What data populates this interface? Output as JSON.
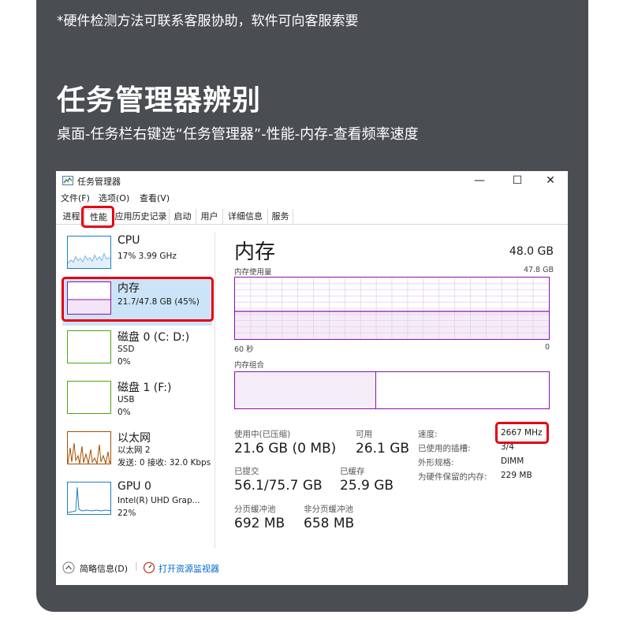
{
  "banner": {
    "note": "*硬件检测方法可联系客服协助，软件可向客服索要",
    "title": "任务管理器辨别",
    "subtitle": "桌面-任务栏右键选“任务管理器”-性能-内存-查看频率速度"
  },
  "window": {
    "title": "任务管理器",
    "minimize": "—",
    "maximize": "☐",
    "close": "✕",
    "menu": [
      "文件(F)",
      "选项(O)",
      "查看(V)"
    ],
    "tabs": [
      "进程",
      "性能",
      "应用历史记录",
      "启动",
      "用户",
      "详细信息",
      "服务"
    ],
    "active_tab": "性能"
  },
  "resources": [
    {
      "name": "CPU",
      "line1": "17% 3.99 GHz",
      "line2": ""
    },
    {
      "name": "内存",
      "line1": "21.7/47.8 GB (45%)",
      "line2": ""
    },
    {
      "name": "磁盘 0 (C: D:)",
      "line1": "SSD",
      "line2": "0%"
    },
    {
      "name": "磁盘 1 (F:)",
      "line1": "USB",
      "line2": "0%"
    },
    {
      "name": "以太网",
      "line1": "以太网 2",
      "line2": "发送: 0 接收: 32.0 Kbps"
    },
    {
      "name": "GPU 0",
      "line1": "Intel(R) UHD Grap...",
      "line2": "22%"
    }
  ],
  "memory": {
    "title": "内存",
    "total": "48.0 GB",
    "usage_label": "内存使用量",
    "usage_max": "47.8 GB",
    "time_left": "60 秒",
    "time_right": "0",
    "composition_label": "内存组合",
    "in_use_fraction": 0.45,
    "stats": {
      "in_use_label": "使用中(已压缩)",
      "in_use_value": "21.6 GB (0 MB)",
      "available_label": "可用",
      "available_value": "26.1 GB",
      "committed_label": "已提交",
      "committed_value": "56.1/75.7 GB",
      "cached_label": "已缓存",
      "cached_value": "25.9 GB",
      "paged_label": "分页缓冲池",
      "paged_value": "692 MB",
      "nonpaged_label": "非分页缓冲池",
      "nonpaged_value": "658 MB"
    },
    "specs": {
      "speed_label": "速度:",
      "speed_value": "2667 MHz",
      "slots_label": "已使用的插槽:",
      "slots_value": "3/4",
      "form_label": "外形规格:",
      "form_value": "DIMM",
      "reserved_label": "为硬件保留的内存:",
      "reserved_value": "229 MB"
    }
  },
  "footer": {
    "fewer_details": "简略信息(D)",
    "open_monitor": "打开资源监视器"
  },
  "colors": {
    "panel": "#4a4d52",
    "highlight": "#e50012",
    "memory_accent": "#8b12ae",
    "selected_bg": "#cce4f7",
    "link": "#0066cc"
  }
}
